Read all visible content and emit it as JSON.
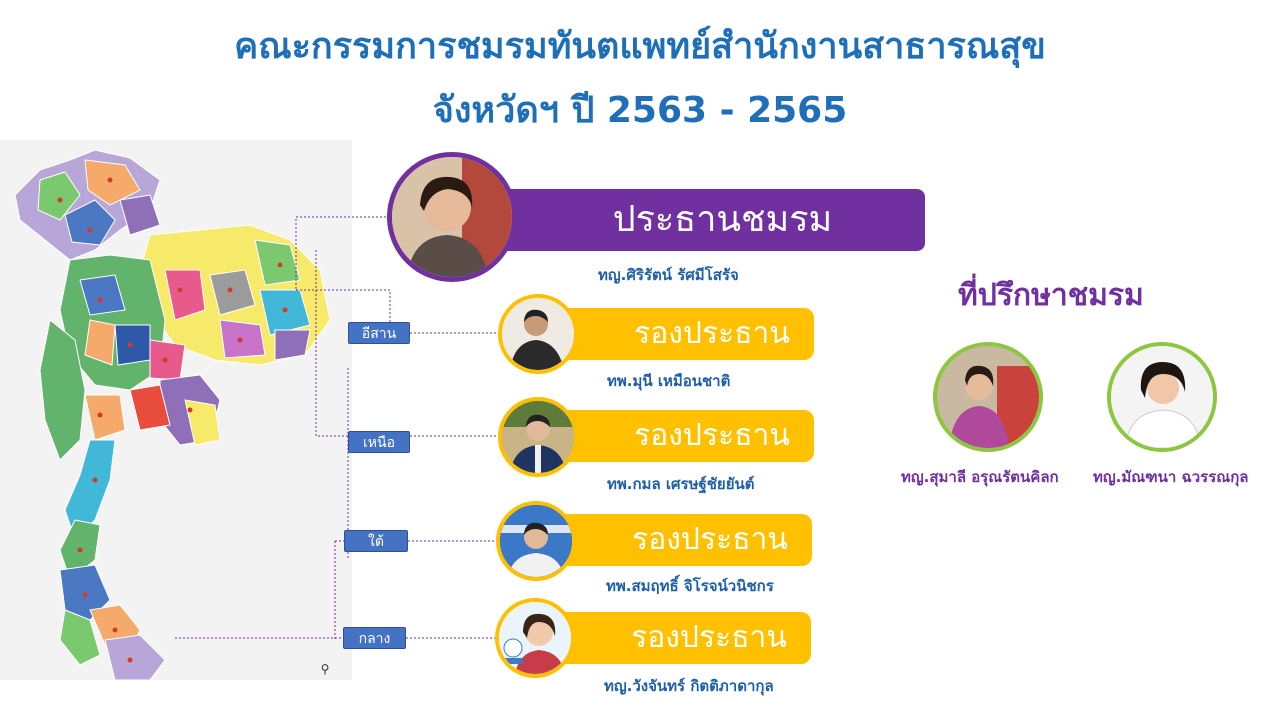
{
  "title": {
    "line1": "คณะกรรมการชมรมทันตแพทย์สำนักงานสาธารณสุข",
    "line2": "จังหวัดฯ ปี 2563 - 2565"
  },
  "regions": {
    "isan": "อีสาน",
    "north": "เหนือ",
    "south": "ใต้",
    "central": "กลาง"
  },
  "chair": {
    "role": "ประธานชมรม",
    "name": "ทญ.ศิริรัตน์ รัศมีโสรัจ"
  },
  "vice_chairs": [
    {
      "role": "รองประธาน",
      "name": "ทพ.มุนี เหมือนชาติ"
    },
    {
      "role": "รองประธาน",
      "name": "ทพ.กมล เศรษฐ์ชัยยันต์"
    },
    {
      "role": "รองประธาน",
      "name": "ทพ.สมฤทธิ์ จิโรจน์วนิชกร"
    },
    {
      "role": "รองประธาน",
      "name": "ทญ.วังจันทร์ กิตติภาดากุล"
    }
  ],
  "advisors": {
    "title": "ที่ปรึกษาชมรม",
    "people": [
      {
        "name": "ทญ.สุมาลี อรุณรัตนคิลก"
      },
      {
        "name": "ทญ.มัณฑนา ฉวรรณกุล"
      }
    ]
  },
  "colors": {
    "title_blue": "#1f6fb8",
    "chair_purple": "#7030a0",
    "vice_gold": "#ffc000",
    "region_blue": "#4472c4",
    "advisor_green": "#8dc63f"
  },
  "icons": {
    "zoom": "zoom-icon"
  }
}
